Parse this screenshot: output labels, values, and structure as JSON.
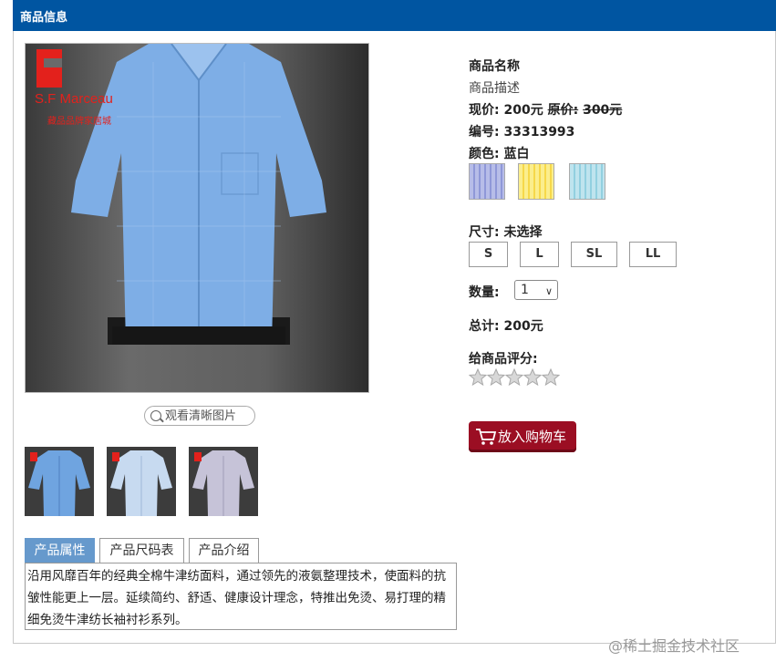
{
  "header": {
    "title": "商品信息"
  },
  "image": {
    "logo_brand": "S.F Marceau",
    "logo_sub": "藏品品牌家居城",
    "zoom_label": "观看清晰图片",
    "thumbnails": [
      {
        "name": "shirt-blue",
        "color": "#6fa4e0"
      },
      {
        "name": "shirt-lightblue",
        "color": "#c7daf0"
      },
      {
        "name": "shirt-lavender",
        "color": "#c6c3d8"
      }
    ]
  },
  "tabs": [
    {
      "label": "产品属性",
      "active": true
    },
    {
      "label": "产品尺码表",
      "active": false
    },
    {
      "label": "产品介绍",
      "active": false
    }
  ],
  "description": "沿用风靡百年的经典全棉牛津纺面料，通过领先的液氨整理技术，使面料的抗皱性能更上一层。延续简约、舒适、健康设计理念，特推出免烫、易打理的精细免烫牛津纺长袖衬衫系列。",
  "product": {
    "name": "商品名称",
    "desc": "商品描述",
    "price_label": "现价:",
    "price": "200元",
    "orig_label": "原价:",
    "orig_price": "300元",
    "sku_label": "编号:",
    "sku": "33313993",
    "color_label": "颜色:",
    "color": "蓝白",
    "swatches": [
      {
        "name": "blue-stripe",
        "base": "#b7bde8",
        "stripe": "#8f98d8"
      },
      {
        "name": "yellow-stripe",
        "base": "#fbee8d",
        "stripe": "#f6d84a"
      },
      {
        "name": "cyan-stripe",
        "base": "#bfe4ee",
        "stripe": "#92d0e0"
      }
    ],
    "size_label": "尺寸:",
    "size_value": "未选择",
    "sizes": [
      "S",
      "L",
      "SL",
      "LL"
    ],
    "qty_label": "数量:",
    "qty": "1",
    "total_label": "总计:",
    "total": "200元",
    "rating_label": "给商品评分:",
    "rating": 0,
    "rating_max": 5,
    "cart_label": "放入购物车"
  },
  "watermark": "@稀土掘金技术社区",
  "colors": {
    "header": "#0055a1",
    "tab_active": "#6699cc",
    "cart": "#9b0e23"
  }
}
